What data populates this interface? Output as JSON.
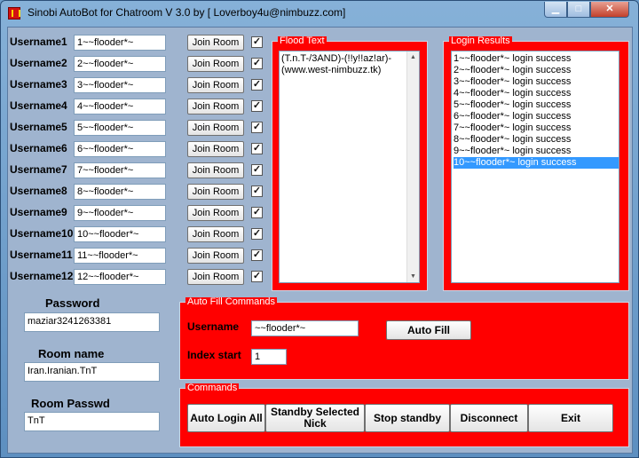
{
  "window": {
    "title": "Sinobi AutoBot for Chatroom V 3.0   by  [ Loverboy4u@nimbuzz.com]",
    "min_glyph": "▁",
    "max_glyph": "□",
    "close_glyph": "✕"
  },
  "users": [
    {
      "label": "Username1",
      "value": "1~~flooder*~",
      "button": "Join Room",
      "checked": "✓"
    },
    {
      "label": "Username2",
      "value": "2~~flooder*~",
      "button": "Join Room",
      "checked": "✓"
    },
    {
      "label": "Username3",
      "value": "3~~flooder*~",
      "button": "Join Room",
      "checked": "✓"
    },
    {
      "label": "Username4",
      "value": "4~~flooder*~",
      "button": "Join Room",
      "checked": "✓"
    },
    {
      "label": "Username5",
      "value": "5~~flooder*~",
      "button": "Join Room",
      "checked": "✓"
    },
    {
      "label": "Username6",
      "value": "6~~flooder*~",
      "button": "Join Room",
      "checked": "✓"
    },
    {
      "label": "Username7",
      "value": "7~~flooder*~",
      "button": "Join Room",
      "checked": "✓"
    },
    {
      "label": "Username8",
      "value": "8~~flooder*~",
      "button": "Join Room",
      "checked": "✓"
    },
    {
      "label": "Username9",
      "value": "9~~flooder*~",
      "button": "Join Room",
      "checked": "✓"
    },
    {
      "label": "Username10",
      "value": "10~~flooder*~",
      "button": "Join Room",
      "checked": "✓"
    },
    {
      "label": "Username11",
      "value": "11~~flooder*~",
      "button": "Join Room",
      "checked": "✓"
    },
    {
      "label": "Username12",
      "value": "12~~flooder*~",
      "button": "Join Room",
      "checked": "✓"
    }
  ],
  "password": {
    "label": "Password",
    "value": "maziar3241263381"
  },
  "room_name": {
    "label": "Room name",
    "value": "Iran.Iranian.TnT"
  },
  "room_passwd": {
    "label": "Room Passwd",
    "value": "TnT"
  },
  "flood_text": {
    "title": "Flood Text",
    "lines": [
      "(T.n.T-/3AND)-(!!y!!az!ar)-",
      "(www.west-nimbuzz.tk)"
    ],
    "scroll_up": "▲",
    "scroll_down": "▼"
  },
  "login_results": {
    "title": "Login Results",
    "items": [
      "1~~flooder*~ login success",
      "2~~flooder*~ login success",
      "3~~flooder*~ login success",
      "4~~flooder*~ login success",
      "5~~flooder*~ login success",
      "6~~flooder*~ login success",
      "7~~flooder*~ login success",
      "8~~flooder*~ login success",
      "9~~flooder*~ login success",
      "10~~flooder*~ login success"
    ],
    "selected_index": 9
  },
  "auto_fill": {
    "title": "Auto Fill Commands",
    "username_label": "Username",
    "username_value": "~~flooder*~",
    "index_label": "Index start",
    "index_value": "1",
    "button": "Auto Fill"
  },
  "commands": {
    "title": "Commands",
    "auto_login": "Auto Login All",
    "standby_line1": "Standby Selected",
    "standby_line2": "Nick",
    "stop_standby": "Stop standby",
    "disconnect": "Disconnect",
    "exit": "Exit"
  }
}
